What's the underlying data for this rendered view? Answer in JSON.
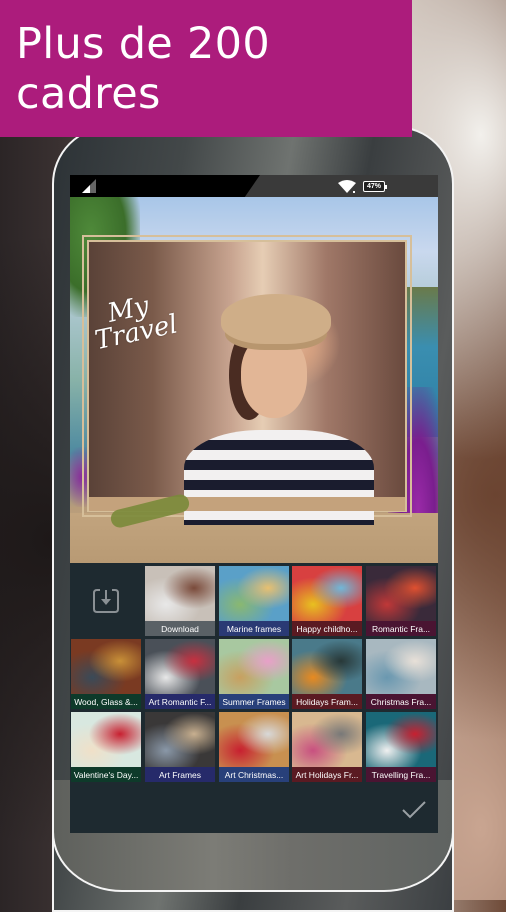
{
  "banner": {
    "title": "Plus de 200 cadres",
    "color": "#ac1c7c"
  },
  "status_bar": {
    "signal_icon": "signal-icon",
    "wifi_icon": "wifi-icon",
    "battery": "47%"
  },
  "photo": {
    "overlay_text_line1": "My",
    "overlay_text_line2": "Travel",
    "frame_style": "rope marine frame"
  },
  "frames": {
    "download_icon": "download-icon",
    "items": [
      {
        "label": "Download",
        "label_color": "#5a6166",
        "thumb": [
          "#c8c0b8",
          "#7a4a3a",
          "#e8e8e8"
        ]
      },
      {
        "label": "Marine frames",
        "label_color": "#2a3a74",
        "thumb": [
          "#5aa0c8",
          "#e8c070",
          "#8ab870"
        ]
      },
      {
        "label": "Happy childho...",
        "label_color": "#5a1a22",
        "thumb": [
          "#d84040",
          "#70b8d8",
          "#e8c020"
        ]
      },
      {
        "label": "Romantic Fra...",
        "label_color": "#4a1432",
        "thumb": [
          "#3a2a3a",
          "#e05030",
          "#c03838"
        ]
      },
      {
        "label": "Wood, Glass &...",
        "label_color": "#0e3a2a",
        "thumb": [
          "#7a3a22",
          "#c89038",
          "#3a4a58"
        ]
      },
      {
        "label": "Art Romantic F...",
        "label_color": "#262a6a",
        "thumb": [
          "#4a5058",
          "#c83040",
          "#e8e8e8"
        ]
      },
      {
        "label": "Summer Frames",
        "label_color": "#28407a",
        "thumb": [
          "#a8c8a0",
          "#e8a0c8",
          "#c8a060"
        ]
      },
      {
        "label": "Holidays Fram...",
        "label_color": "#5a1a22",
        "thumb": [
          "#4a7a8a",
          "#283838",
          "#e88a20"
        ]
      },
      {
        "label": "Christmas Fra...",
        "label_color": "#4a1432",
        "thumb": [
          "#a8b8c0",
          "#e8e0d8",
          "#6a98b0"
        ]
      },
      {
        "label": "Valentine's Day...",
        "label_color": "#0e3a2a",
        "thumb": [
          "#d8e8e0",
          "#c82030",
          "#f0e0c8"
        ]
      },
      {
        "label": "Art Frames",
        "label_color": "#262a6a",
        "thumb": [
          "#3a3838",
          "#c8b090",
          "#8a98a8"
        ]
      },
      {
        "label": "Art Christmas...",
        "label_color": "#28407a",
        "thumb": [
          "#c89050",
          "#d8d8d8",
          "#c82030"
        ]
      },
      {
        "label": "Art Holidays Fr...",
        "label_color": "#5a1a22",
        "thumb": [
          "#d8b890",
          "#787878",
          "#c85080"
        ]
      },
      {
        "label": "Travelling Fra...",
        "label_color": "#4a1432",
        "thumb": [
          "#1a6878",
          "#c82030",
          "#f0f0f0"
        ]
      }
    ]
  },
  "confirm": {
    "icon": "checkmark-icon"
  }
}
